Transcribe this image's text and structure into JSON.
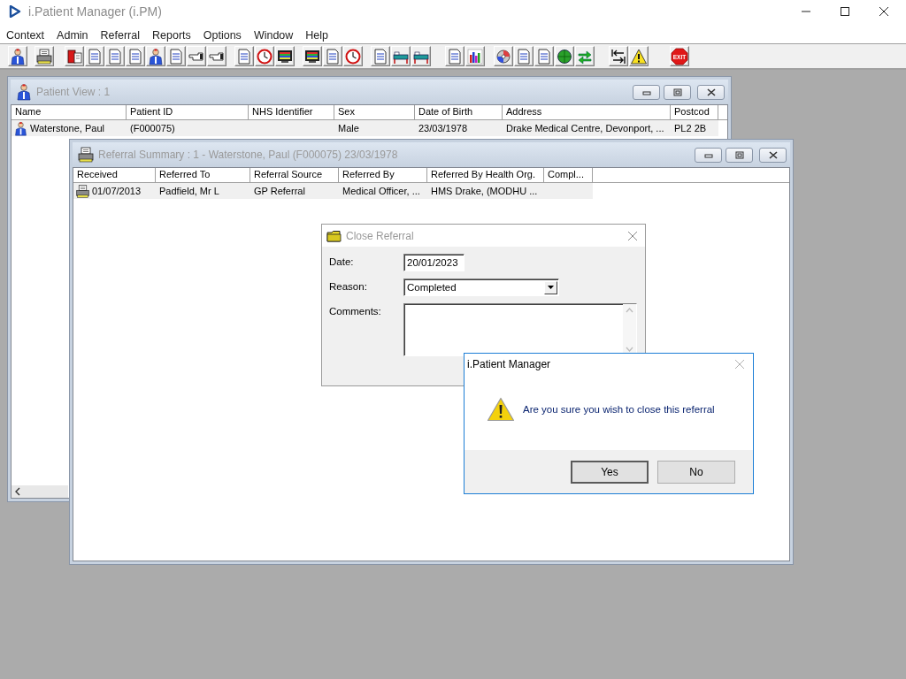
{
  "app": {
    "title": "i.Patient Manager (i.PM)"
  },
  "menu": [
    "Context",
    "Admin",
    "Referral",
    "Reports",
    "Options",
    "Window",
    "Help"
  ],
  "toolbar": {
    "exit_label": "EXIT",
    "groups": [
      [
        {
          "kind": "person"
        }
      ],
      [
        {
          "kind": "printer"
        }
      ],
      [
        {
          "kind": "book"
        },
        {
          "kind": "doc"
        },
        {
          "kind": "doc"
        },
        {
          "kind": "doc"
        },
        {
          "kind": "person"
        },
        {
          "kind": "doc"
        },
        {
          "kind": "hand"
        },
        {
          "kind": "hand"
        }
      ],
      [
        {
          "kind": "doc"
        },
        {
          "kind": "clock"
        },
        {
          "kind": "screen"
        }
      ],
      [
        {
          "kind": "screen"
        },
        {
          "kind": "doc"
        },
        {
          "kind": "clock"
        }
      ],
      [
        {
          "kind": "doc"
        },
        {
          "kind": "bed"
        },
        {
          "kind": "bed"
        }
      ],
      [
        {
          "kind": "doc"
        },
        {
          "kind": "chart"
        }
      ],
      [
        {
          "kind": "disc"
        },
        {
          "kind": "doc"
        },
        {
          "kind": "doc"
        },
        {
          "kind": "globe"
        },
        {
          "kind": "arrows"
        }
      ],
      [
        {
          "kind": "swap"
        },
        {
          "kind": "warning"
        }
      ],
      [
        {
          "kind": "exit"
        }
      ]
    ]
  },
  "patient_view": {
    "title": "Patient View : 1",
    "active": false,
    "columns": [
      "Name",
      "Patient ID",
      "NHS Identifier",
      "Sex",
      "Date of Birth",
      "Address",
      "Postcod"
    ],
    "rows": [
      {
        "cells": [
          "Waterstone, Paul",
          "(F000075)",
          "",
          "Male",
          "23/03/1978",
          "Drake Medical Centre, Devonport, ...",
          "PL2 2B"
        ]
      }
    ]
  },
  "referral_summary": {
    "title": "Referral Summary : 1 - Waterstone, Paul (F000075) 23/03/1978",
    "active": false,
    "columns": [
      "Received",
      "Referred To",
      "Referral Source",
      "Referred By",
      "Referred By Health Org.",
      "Compl..."
    ],
    "rows": [
      {
        "cells": [
          "01/07/2013",
          "Padfield, Mr L",
          "GP Referral",
          "Medical Officer, ...",
          "HMS Drake, (MODHU ...",
          ""
        ]
      }
    ]
  },
  "close_referral": {
    "title": "Close Referral",
    "active": false,
    "fields": [
      {
        "kind": "text",
        "label": "Date:",
        "value": "20/01/2023"
      },
      {
        "kind": "dropdown",
        "label": "Reason:",
        "value": "Completed"
      },
      {
        "kind": "textarea",
        "label": "Comments:"
      }
    ]
  },
  "message_box": {
    "title": "i.Patient Manager",
    "active": true,
    "message": "Are you sure you wish to close this referral",
    "buttons": [
      {
        "label": "Yes",
        "default": true
      },
      {
        "label": "No",
        "default": false
      }
    ]
  }
}
